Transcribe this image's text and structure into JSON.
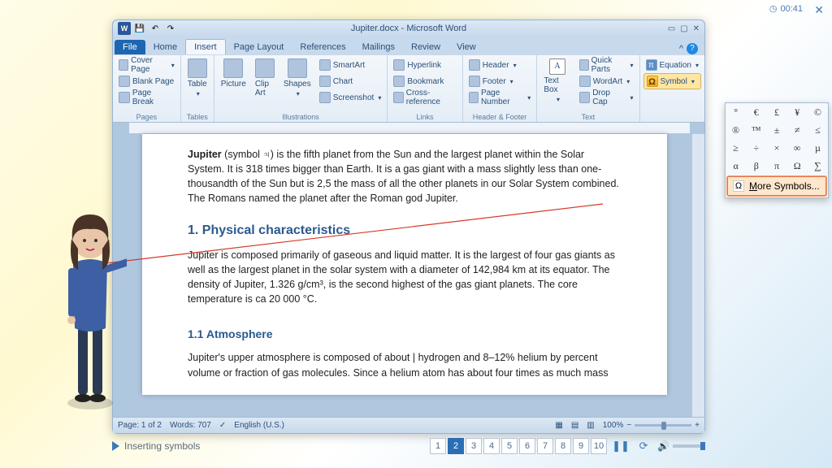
{
  "timer": "00:41",
  "window": {
    "title": "Jupiter.docx - Microsoft Word",
    "qat": {
      "save": "💾",
      "undo": "↶",
      "redo": "↷"
    },
    "controls": {
      "min": "▭",
      "max": "▢",
      "close": "✕"
    }
  },
  "tabs": {
    "file": "File",
    "home": "Home",
    "insert": "Insert",
    "page_layout": "Page Layout",
    "references": "References",
    "mailings": "Mailings",
    "review": "Review",
    "view": "View"
  },
  "ribbon": {
    "pages": {
      "label": "Pages",
      "cover": "Cover Page",
      "blank": "Blank Page",
      "break": "Page Break"
    },
    "tables": {
      "label": "Tables",
      "table": "Table"
    },
    "illustrations": {
      "label": "Illustrations",
      "picture": "Picture",
      "clipart": "Clip Art",
      "shapes": "Shapes",
      "smartart": "SmartArt",
      "chart": "Chart",
      "screenshot": "Screenshot"
    },
    "links": {
      "label": "Links",
      "hyperlink": "Hyperlink",
      "bookmark": "Bookmark",
      "crossref": "Cross-reference"
    },
    "header_footer": {
      "label": "Header & Footer",
      "header": "Header",
      "footer": "Footer",
      "page_number": "Page Number"
    },
    "text": {
      "label": "Text",
      "textbox": "Text Box",
      "quick_parts": "Quick Parts",
      "wordart": "WordArt",
      "drop_cap": "Drop Cap"
    },
    "symbols": {
      "equation": "Equation",
      "symbol": "Symbol"
    }
  },
  "symbol_panel": {
    "grid": [
      "°",
      "€",
      "£",
      "¥",
      "©",
      "®",
      "™",
      "±",
      "≠",
      "≤",
      "≥",
      "÷",
      "×",
      "∞",
      "µ",
      "α",
      "β",
      "π",
      "Ω",
      "∑"
    ],
    "more": "More Symbols..."
  },
  "document": {
    "p1_prefix": "Jupiter",
    "p1_rest": " (symbol ♃) is the fifth planet from the Sun and the largest planet within the Solar System. It is 318 times bigger than Earth. It is a gas giant with a mass slightly less than one-thousandth of the Sun but is 2,5 the mass of all the other planets in our Solar System combined. The Romans named the planet after the Roman god Jupiter.",
    "h1": "1.  Physical characteristics",
    "p2": "Jupiter is composed primarily of gaseous and liquid matter. It is the largest of four gas giants as well as the largest planet in the solar system with a diameter of 142,984 km at its equator. The density of Jupiter, 1.326 g/cm³, is the second highest of the gas giant planets. The core temperature is ca 20 000 °C.",
    "h2": "1.1 Atmosphere",
    "p3": "Jupiter's upper atmosphere is composed of about | hydrogen and 8–12% helium by percent volume or fraction of gas molecules.  Since a helium atom has about four times as much mass"
  },
  "status": {
    "page": "Page: 1 of 2",
    "words": "Words: 707",
    "lang": "English (U.S.)",
    "zoom": "100%"
  },
  "training": {
    "caption": "Inserting symbols",
    "pages": [
      "1",
      "2",
      "3",
      "4",
      "5",
      "6",
      "7",
      "8",
      "9",
      "10"
    ],
    "current": 2
  }
}
